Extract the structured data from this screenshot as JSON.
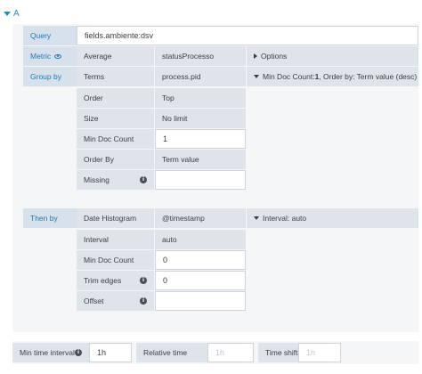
{
  "query_row": {
    "label": "A"
  },
  "query": {
    "label": "Query",
    "value": "fields.ambiente:dsv"
  },
  "metric": {
    "label": "Metric",
    "type": "Average",
    "field": "statusProcesso",
    "options_label": "Options"
  },
  "group_by": {
    "label": "Group by",
    "type": "Terms",
    "field": "process.pid",
    "summary_prefix": "Min Doc Count: ",
    "summary_count": "1",
    "summary_suffix": ", Order by: Term value (desc)",
    "order_label": "Order",
    "order_value": "Top",
    "size_label": "Size",
    "size_value": "No limit",
    "min_doc_label": "Min Doc Count",
    "min_doc_value": "1",
    "order_by_label": "Order By",
    "order_by_value": "Term value",
    "missing_label": "Missing",
    "missing_value": ""
  },
  "then_by": {
    "label": "Then by",
    "type": "Date Histogram",
    "field": "@timestamp",
    "summary": "Interval: auto",
    "interval_label": "Interval",
    "interval_value": "auto",
    "min_doc_label": "Min Doc Count",
    "min_doc_value": "0",
    "trim_label": "Trim edges",
    "trim_value": "0",
    "offset_label": "Offset",
    "offset_value": ""
  },
  "bottom": {
    "min_time_label": "Min time interval",
    "min_time_value": "1h",
    "relative_label": "Relative time",
    "relative_placeholder": "1h",
    "shift_label": "Time shift",
    "shift_placeholder": "1h"
  }
}
